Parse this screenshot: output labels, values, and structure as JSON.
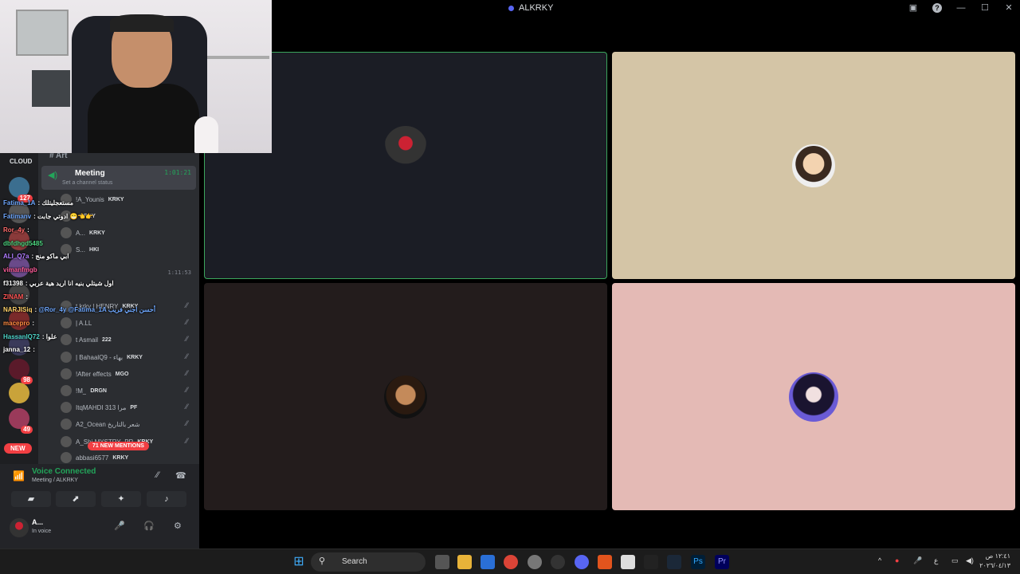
{
  "window": {
    "title": "ALKRKY"
  },
  "titlebar_icons": [
    "screen-icon",
    "help-icon",
    "minimize-icon",
    "maximize-icon",
    "close-icon"
  ],
  "titlebar_glyphs": {
    "screen": "▣",
    "help": "?",
    "minimize": "—",
    "maximize": "☐",
    "close": "✕"
  },
  "stage": {
    "tiles": [
      {
        "name": "tile-1",
        "speaking": true
      },
      {
        "name": "tile-2"
      },
      {
        "name": "tile-3"
      },
      {
        "name": "tile-4"
      }
    ]
  },
  "guilds": {
    "top_label": "CLOUD",
    "badges": [
      "127",
      "98",
      "49"
    ],
    "new_label": "NEW"
  },
  "channels": {
    "category": "# Art",
    "voice_channel": {
      "name": "Meeting",
      "timer": "1:01:21",
      "status_placeholder": "Set a channel status"
    },
    "second_timer": "1:11:53",
    "users": [
      {
        "name": "!A_Younis",
        "tag": "KRKY"
      },
      {
        "name": "",
        "tag": "KRKY"
      },
      {
        "name": "A...",
        "tag": "KRKY"
      },
      {
        "name": "S...",
        "tag": "HKI"
      },
      {
        "name": "t.krky | HENRY",
        "tag": "KRKY"
      },
      {
        "name": "| A.LL",
        "tag": ""
      },
      {
        "name": "t Asmail",
        "tag": "222"
      },
      {
        "name": "| BahaalQ9 - بهاء",
        "tag": "KRKY"
      },
      {
        "name": "!After effects",
        "tag": "MGO"
      },
      {
        "name": "!M_",
        "tag": "DRGN"
      },
      {
        "name": "ItqMAHDI 313 مرا",
        "tag": "PF"
      },
      {
        "name": "A2_Ocean يمي اقوى شعر بالتاريخ",
        "tag": ""
      },
      {
        "name": "A_Shi.MYSTRY_PR",
        "tag": "KRKY"
      },
      {
        "name": "abbasi6577",
        "tag": "KRKY"
      }
    ],
    "mentions_label": "71 NEW MENTIONS"
  },
  "chat": [
    {
      "user": "Fatima_1A",
      "msg": "مستعجليتلك",
      "color": "#6fa8ff"
    },
    {
      "user": "Fatimanv",
      "msg": "ادوتي جابت 😁👈👉",
      "color": "#6fa8ff"
    },
    {
      "user": "Ror_4y",
      "msg": "",
      "color": "#ff6b6b"
    },
    {
      "user": "dbfdhgd5485",
      "msg": "",
      "color": "#4dd47f"
    },
    {
      "user": "ALI_Q7a",
      "msg": "ابي ماكو منج",
      "color": "#b07cff"
    },
    {
      "user": "vimanfmgb",
      "msg": "",
      "color": "#ff5c9a"
    },
    {
      "user": "f31398",
      "msg": "اول شيتلي بنيه انا اريد هية عربي",
      "color": "#ffffff"
    },
    {
      "user": "ZINAM",
      "msg": "",
      "color": "#ff5555"
    },
    {
      "user": "NARJISiq",
      "msg": "@Ror_4y @Fatima_1A أحسن اجني فريب",
      "color": "#ffd36b"
    },
    {
      "user": "macepro",
      "msg": "",
      "color": "#ff8c42"
    },
    {
      "user": "HassanIQ72",
      "msg": "علوا",
      "color": "#4dd4c7"
    },
    {
      "user": "janna_12",
      "msg": "",
      "color": "#ffffff"
    }
  ],
  "voice": {
    "status": "Voice Connected",
    "channel": "Meeting / ALKRKY",
    "user_name": "A...",
    "user_status": "In voice"
  },
  "voice_glyphs": {
    "signal": "📶",
    "noise": "⁄⁄",
    "disconnect": "☎",
    "camera": "▰",
    "screenshare": "⬈",
    "activity": "✦",
    "soundboard": "♪",
    "mic": "🎤",
    "headphones": "🎧",
    "settings": "⚙"
  },
  "taskbar": {
    "search_label": "Search",
    "time": "١٢:٤١ ص",
    "date": "٢٠٢٦/٠٤/١٣"
  },
  "taskbar_glyphs": {
    "start": "⊞",
    "search": "⚲",
    "tray_up": "^",
    "lang": "ع"
  }
}
